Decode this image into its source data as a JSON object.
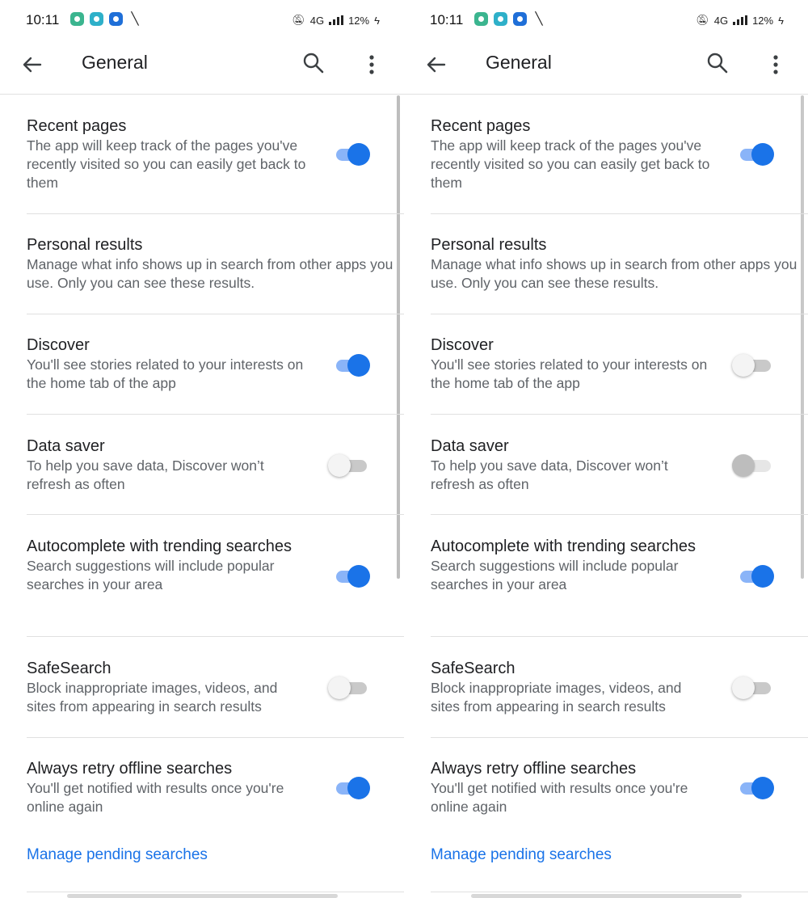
{
  "statusbar": {
    "time": "10:11",
    "network": "4G",
    "battery": "12%"
  },
  "appbar": {
    "title": "General",
    "icons": [
      "back-arrow-icon",
      "search-icon",
      "more-vert-icon"
    ]
  },
  "colors": {
    "accent": "#1a73e8",
    "toggle_on_track": "#8ab4f8",
    "text_primary": "#202124",
    "text_secondary": "#5f6368"
  },
  "settings": [
    {
      "title": "Recent pages",
      "description": "The app will keep track of the pages you've recently visited so you can easily get back to them",
      "has_toggle": true
    },
    {
      "title": "Personal results",
      "description": "Manage what info shows up in search from other apps you use. Only you can see these results.",
      "has_toggle": false
    },
    {
      "title": "Discover",
      "description": "You'll see stories related to your interests on the home tab of the app",
      "has_toggle": true
    },
    {
      "title": "Data saver",
      "description": "To help you save data, Discover won’t refresh as often",
      "has_toggle": true
    },
    {
      "title": "Autocomplete with trending searches",
      "description": "Search suggestions will include popular searches in your area",
      "has_toggle": true
    },
    {
      "title": "SafeSearch",
      "description": "Block inappropriate images, videos, and sites from appearing in search results",
      "has_toggle": true
    },
    {
      "title": "Always retry offline searches",
      "description": "You'll get notified with results once you're online again",
      "has_toggle": true
    }
  ],
  "screens": [
    {
      "name": "left",
      "toggles": {
        "recent_pages": "on",
        "discover": "on",
        "data_saver": "off",
        "autocomplete": "on",
        "safesearch": "off",
        "retry_offline": "on"
      }
    },
    {
      "name": "right",
      "toggles": {
        "recent_pages": "on",
        "discover": "off",
        "data_saver": "disabled",
        "autocomplete": "on",
        "safesearch": "off",
        "retry_offline": "on"
      }
    }
  ],
  "manage_link": "Manage pending searches"
}
